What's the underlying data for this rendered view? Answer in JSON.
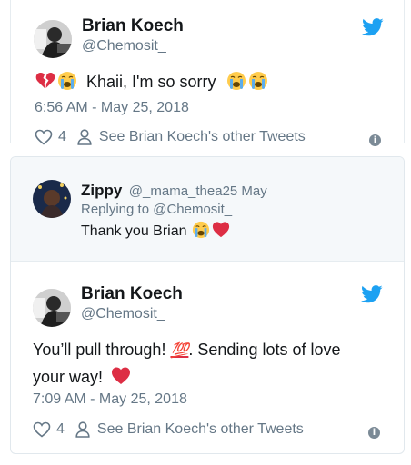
{
  "tweet1": {
    "name": "Brian Koech",
    "handle": "@Chemosit_",
    "text": "Khaii, I'm so sorry",
    "timestamp": "6:56 AM - May 25, 2018",
    "likes": "4",
    "see_more": "See Brian Koech's other Tweets"
  },
  "reply": {
    "name": "Zippy",
    "handle": "@_mama_thea",
    "date": "25 May",
    "replying_to": "Replying to @Chemosit_",
    "text": "Thank you Brian"
  },
  "tweet2": {
    "name": "Brian Koech",
    "handle": "@Chemosit_",
    "text_line1": "You’ll pull through!",
    "text_line1b": ". Sending lots of love",
    "text_line2": "your way!",
    "hundred": "💯",
    "timestamp": "7:09 AM - May 25, 2018",
    "likes": "4",
    "see_more": "See Brian Koech's other Tweets"
  },
  "colors": {
    "twitter_blue": "#1da1f2",
    "heart_red": "#e0245e",
    "gray": "#657786"
  },
  "icons": [
    "twitter-bird-icon",
    "broken-heart-emoji",
    "crying-face-emoji",
    "red-heart-emoji",
    "hundred-points-emoji",
    "heart-outline-icon",
    "person-icon",
    "info-icon"
  ]
}
